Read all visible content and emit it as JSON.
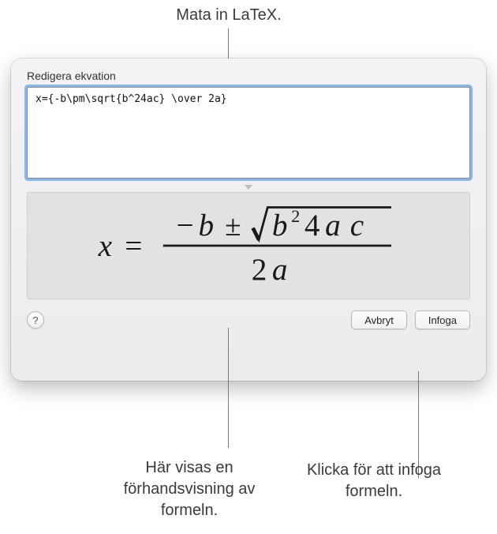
{
  "callouts": {
    "top": "Mata in LaTeX.",
    "bottom_left": "Här visas en förhandsvisning av formeln.",
    "bottom_right": "Klicka för att infoga formeln."
  },
  "dialog": {
    "title": "Redigera ekvation",
    "latex_value": "x={-b\\pm\\sqrt{b^24ac} \\over 2a}",
    "help_label": "?",
    "cancel_label": "Avbryt",
    "insert_label": "Infoga"
  }
}
